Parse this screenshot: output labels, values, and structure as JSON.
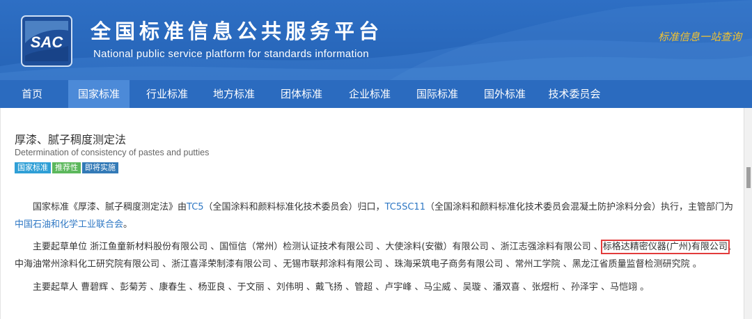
{
  "header": {
    "logo_text": "SAC",
    "title_cn": "全国标准信息公共服务平台",
    "title_en": "National public service platform  for standards information",
    "slogan": "标准信息一站查询"
  },
  "nav": {
    "items": [
      {
        "label": "首页"
      },
      {
        "label": "国家标准"
      },
      {
        "label": "行业标准"
      },
      {
        "label": "地方标准"
      },
      {
        "label": "团体标准"
      },
      {
        "label": "企业标准"
      },
      {
        "label": "国际标准"
      },
      {
        "label": "国外标准"
      },
      {
        "label": "技术委员会"
      }
    ],
    "active_index": 1
  },
  "standard": {
    "title": "厚漆、腻子稠度测定法",
    "title_en": "Determination of consistency of pastes and putties",
    "badges": [
      "国家标准",
      "推荐性",
      "即将实施"
    ]
  },
  "paragraph1": {
    "text1": "国家标准《厚漆、腻子稠度测定法》由",
    "tc_link": "TC5",
    "text2": "（全国涂料和颜料标准化技术委员会）归口，",
    "sc_link": "TC5SC11",
    "text3": "（全国涂料和颜料标准化技术委员会混凝土防护涂料分会）执行，主管部门为",
    "dept_link": "中国石油和化学工业联合会",
    "text4": "。"
  },
  "paragraph2": {
    "label": "主要起草单位 ",
    "units_before": "浙江鱼童新材料股份有限公司 、国恒信（常州）检测认证技术有限公司 、大使涂料(安徽）有限公司 、浙江志强涂料有限公司 、",
    "highlight_unit": "标格达精密仪器(广州)有限公司",
    "units_after": "、中海油常州涂料化工研究院有限公司 、浙江喜泽荣制漆有限公司 、无锡市联邦涂料有限公司 、珠海采筑电子商务有限公司 、常州工学院 、黑龙江省质量监督检测研究院 。"
  },
  "paragraph3": {
    "label": "主要起草人 ",
    "names": "曹碧辉 、彭菊芳 、康春生 、杨亚良 、于文丽 、刘伟明 、戴飞扬 、管超 、卢宇峰 、马尘威 、吴璇 、潘双喜 、张煜桁 、孙泽宇 、马恺翊 。"
  },
  "colors": {
    "header_bg": "#2e6fc4",
    "nav_bg": "#2b6bbf",
    "nav_active": "#4c8ad8",
    "link": "#2f78c4",
    "highlight_border": "#e23b3b"
  }
}
